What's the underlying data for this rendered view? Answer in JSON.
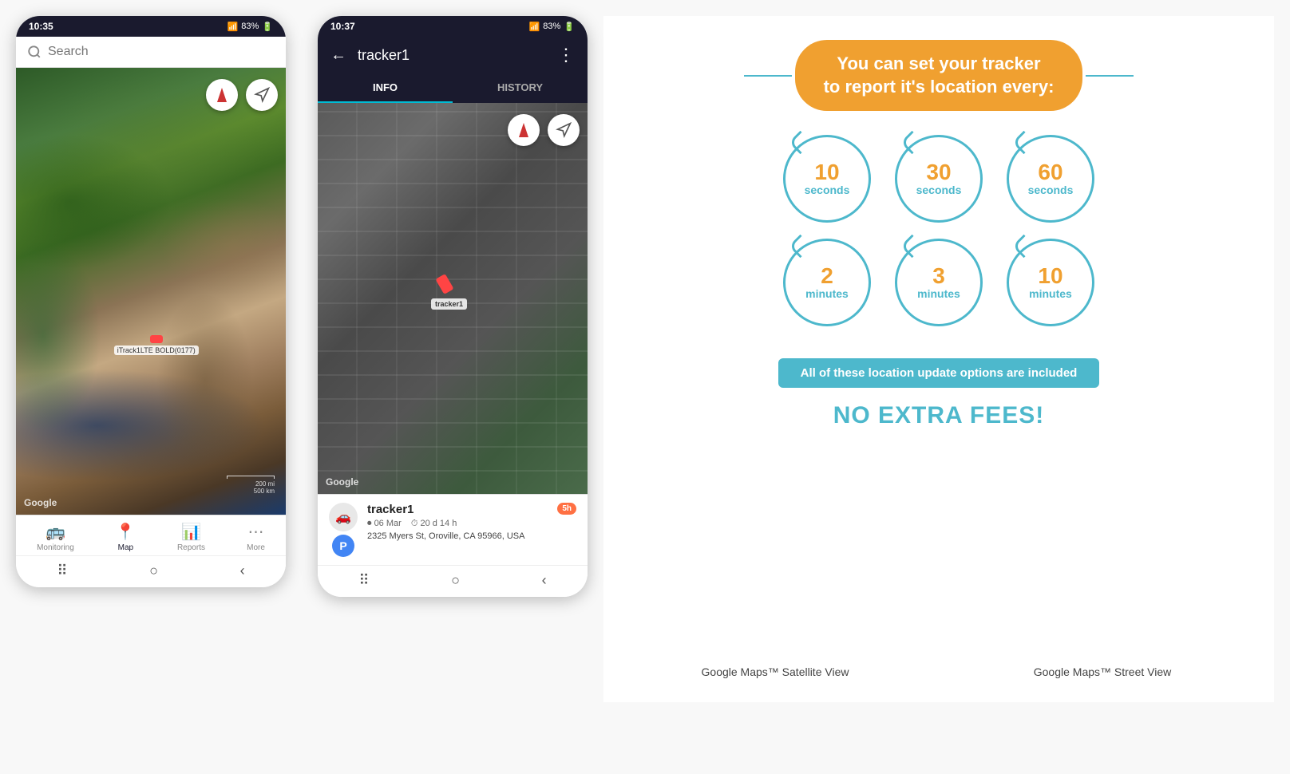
{
  "phone1": {
    "status_time": "10:35",
    "status_signal": "📶",
    "status_battery": "83%",
    "search_placeholder": "Search",
    "tracker_label": "iTrack1LTE BOLD(0177)",
    "google_label": "Google",
    "scale_200mi": "200 mi",
    "scale_500km": "500 km",
    "nav_items": [
      {
        "label": "Monitoring",
        "icon": "🚌",
        "active": false
      },
      {
        "label": "Map",
        "icon": "📍",
        "active": true
      },
      {
        "label": "Reports",
        "icon": "📊",
        "active": false
      },
      {
        "label": "More",
        "icon": "•••",
        "active": false
      }
    ],
    "caption": "Google Maps™ Satellite View"
  },
  "phone2": {
    "status_time": "10:37",
    "status_signal": "📶",
    "status_battery": "83%",
    "tracker_name": "tracker1",
    "tab_info": "INFO",
    "tab_history": "HISTORY",
    "google_label": "Google",
    "tracker_info": {
      "name": "tracker1",
      "date": "06 Mar",
      "duration": "20 d 14 h",
      "address": "2325 Myers St, Oroville, CA 95966, USA",
      "time_badge": "5h"
    },
    "aerial_tracker_label": "tracker1",
    "caption": "Google Maps™ Street View"
  },
  "info_panel": {
    "headline_line1": "You can set your tracker",
    "headline_line2": "to report it's location every:",
    "circles": [
      {
        "number": "10",
        "unit": "seconds"
      },
      {
        "number": "30",
        "unit": "seconds"
      },
      {
        "number": "60",
        "unit": "seconds"
      },
      {
        "number": "2",
        "unit": "minutes"
      },
      {
        "number": "3",
        "unit": "minutes"
      },
      {
        "number": "10",
        "unit": "minutes"
      }
    ],
    "banner_text": "All of these location update options are included",
    "no_fees_text": "NO EXTRA FEES!"
  }
}
